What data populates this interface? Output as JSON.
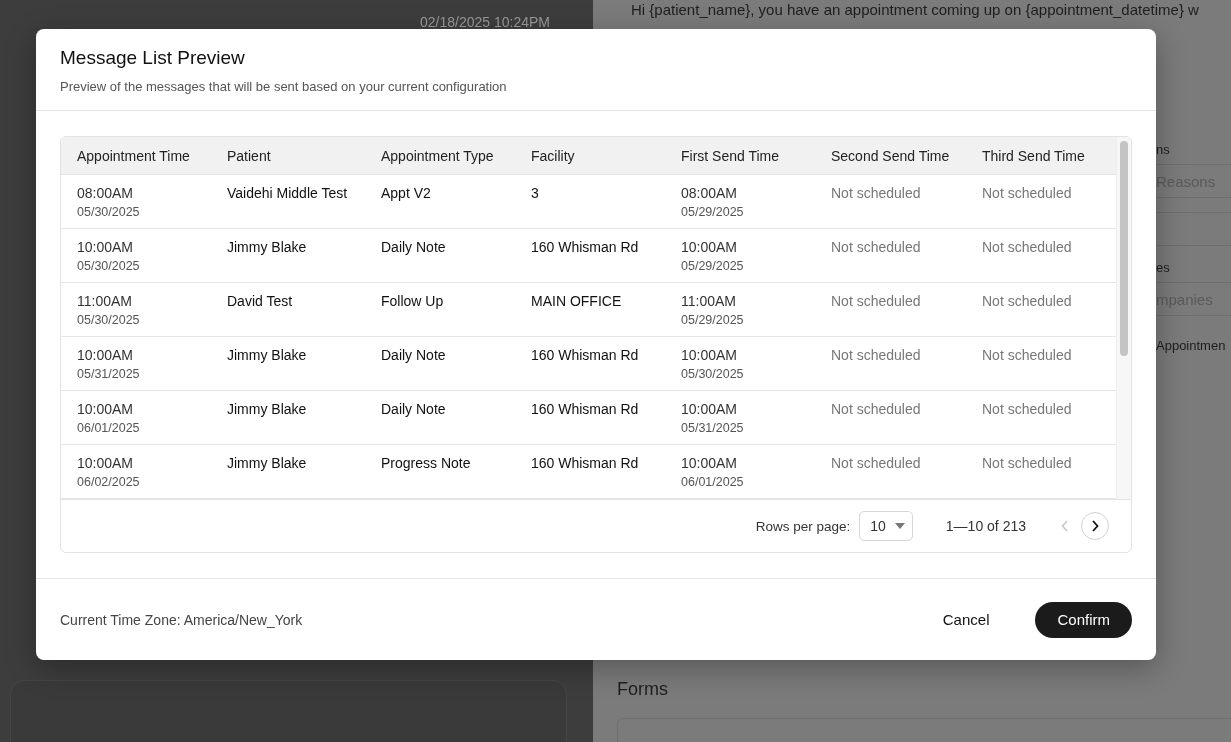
{
  "background": {
    "left_panel": {
      "timestamp": "02/18/2025 10:24PM"
    },
    "right_panel": {
      "message_template": "Hi {patient_name}, you have an appointment coming up on {appointment_datetime} w",
      "fragments": [
        {
          "kind": "label",
          "text": "ns"
        },
        {
          "kind": "field",
          "text": "Reasons"
        },
        {
          "kind": "field"
        },
        {
          "kind": "label",
          "text": "es"
        },
        {
          "kind": "field",
          "text": "mpanies"
        },
        {
          "kind": "label",
          "text": "Appointmen"
        }
      ],
      "section_title": "Forms"
    }
  },
  "dialog": {
    "title": "Message List Preview",
    "subtitle": "Preview of the messages that will be sent based on your current configuration",
    "table": {
      "columns": [
        "Appointment Time",
        "Patient",
        "Appointment Type",
        "Facility",
        "First Send Time",
        "Second Send Time",
        "Third Send Time"
      ],
      "rows": [
        {
          "appt_time": "08:00AM",
          "appt_date": "05/30/2025",
          "patient": "Vaidehi Middle Test",
          "type": "Appt V2",
          "facility": "3",
          "first_time": "08:00AM",
          "first_date": "05/29/2025",
          "second": "Not scheduled",
          "third": "Not scheduled"
        },
        {
          "appt_time": "10:00AM",
          "appt_date": "05/30/2025",
          "patient": "Jimmy Blake",
          "type": "Daily Note",
          "facility": "160 Whisman Rd",
          "first_time": "10:00AM",
          "first_date": "05/29/2025",
          "second": "Not scheduled",
          "third": "Not scheduled"
        },
        {
          "appt_time": "11:00AM",
          "appt_date": "05/30/2025",
          "patient": "David Test",
          "type": "Follow Up",
          "facility": "MAIN OFFICE",
          "first_time": "11:00AM",
          "first_date": "05/29/2025",
          "second": "Not scheduled",
          "third": "Not scheduled"
        },
        {
          "appt_time": "10:00AM",
          "appt_date": "05/31/2025",
          "patient": "Jimmy Blake",
          "type": "Daily Note",
          "facility": "160 Whisman Rd",
          "first_time": "10:00AM",
          "first_date": "05/30/2025",
          "second": "Not scheduled",
          "third": "Not scheduled"
        },
        {
          "appt_time": "10:00AM",
          "appt_date": "06/01/2025",
          "patient": "Jimmy Blake",
          "type": "Daily Note",
          "facility": "160 Whisman Rd",
          "first_time": "10:00AM",
          "first_date": "05/31/2025",
          "second": "Not scheduled",
          "third": "Not scheduled"
        },
        {
          "appt_time": "10:00AM",
          "appt_date": "06/02/2025",
          "patient": "Jimmy Blake",
          "type": "Progress Note",
          "facility": "160 Whisman Rd",
          "first_time": "10:00AM",
          "first_date": "06/01/2025",
          "second": "Not scheduled",
          "third": "Not scheduled"
        }
      ]
    },
    "pagination": {
      "rows_per_page_label": "Rows per page:",
      "rows_per_page": "10",
      "range": "1—10 of 213",
      "prev_disabled": true,
      "next_disabled": false
    },
    "timezone": "Current Time Zone: America/New_York",
    "buttons": [
      {
        "kind": "text",
        "label": "Cancel"
      },
      {
        "kind": "primary",
        "label": "Confirm"
      }
    ]
  }
}
